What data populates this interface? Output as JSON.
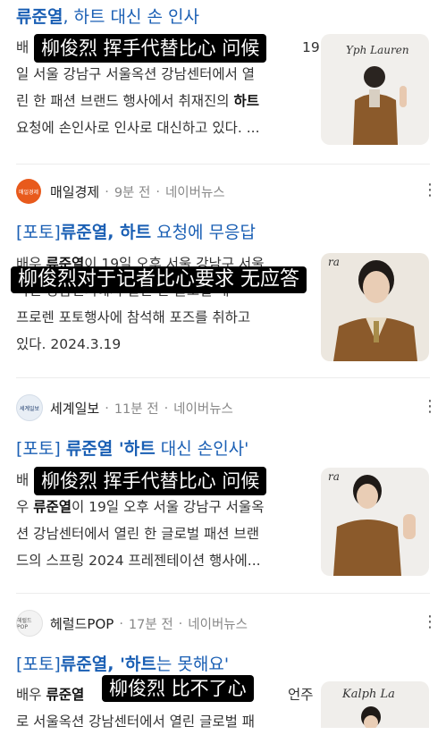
{
  "articles": [
    {
      "title_name": "류준열",
      "title_rest": ", 하트 대신 손 인사",
      "lines": [
        {
          "pre": "배",
          "bold": "",
          "post": "",
          "tail": "19"
        },
        {
          "pre": "일 서울 강남구 서울옥션 강남센터에서 열",
          "bold": "",
          "post": ""
        },
        {
          "pre": "린 한 패션 브랜드 행사에서 취재진의 ",
          "bold": "하트",
          "post": ""
        },
        {
          "pre": "요청에 손인사로 인사로 대신하고 있다. ...",
          "bold": "",
          "post": ""
        }
      ],
      "thumb_text": "Yph Lauren",
      "subtitle": "柳俊烈 挥手代替比心 问候"
    },
    {
      "source": "매일경제",
      "logo_text": "매일경제",
      "time": "9분 전",
      "sep": "·",
      "site": "네이버뉴스",
      "title_prefix": "[포토]",
      "title_name": "류준열",
      "title_mid": ", 하트",
      "title_rest": " 요청에 무응답",
      "lines": [
        {
          "pre": "배우 ",
          "bold": "류준열",
          "post": "이 19일 오후 서울 강남구 서울"
        },
        {
          "pre": "옥션 강남센터에서 열린 한 글로벌 패",
          "bold": "",
          "post": ""
        },
        {
          "pre": "프로렌 포토행사에 참석해 포즈를 취하고",
          "bold": "",
          "post": ""
        },
        {
          "pre": "있다. 2024.3.19",
          "bold": "",
          "post": ""
        }
      ],
      "thumb_text": "ra",
      "subtitle": "柳俊烈对于记者比心要求 无应答"
    },
    {
      "source": "세계일보",
      "logo_text": "세계일보",
      "time": "11분 전",
      "sep": "·",
      "site": "네이버뉴스",
      "title_prefix": "[포토] ",
      "title_name": "류준열",
      "title_mid": " '하트",
      "title_rest": " 대신 손인사'",
      "lines": [
        {
          "pre": "배",
          "bold": "",
          "post": ""
        },
        {
          "pre": "우 ",
          "bold": "류준열",
          "post": "이 19일 오후 서울 강남구 서울옥"
        },
        {
          "pre": "션 강남센터에서 열린 한 글로벌 패션 브랜",
          "bold": "",
          "post": ""
        },
        {
          "pre": "드의 스프링 2024 프레젠테이션 행사에...",
          "bold": "",
          "post": ""
        }
      ],
      "thumb_text": "ra",
      "subtitle": "柳俊烈 挥手代替比心 问候"
    },
    {
      "source": "헤럴드POP",
      "logo_text": "헤럴드POP",
      "time": "17분 전",
      "sep": "·",
      "site": "네이버뉴스",
      "title_prefix": "[포토]",
      "title_name": "류준열",
      "title_mid": ", '하트",
      "title_rest": "는 못해요'",
      "lines": [
        {
          "pre": "배우 ",
          "bold": "류준열",
          "post": "",
          "tail": "언주"
        },
        {
          "pre": "로 서울옥션 강남센터에서 열린 글로벌 패",
          "bold": "",
          "post": ""
        }
      ],
      "thumb_text": "Kalph La",
      "subtitle": "柳俊烈 比不了心"
    }
  ],
  "colors": {
    "title_blue": "#1a5fb4",
    "subtitle_bg": "#000000",
    "meta_gray": "#888888"
  },
  "icons": [
    "more-vertical-icon"
  ]
}
